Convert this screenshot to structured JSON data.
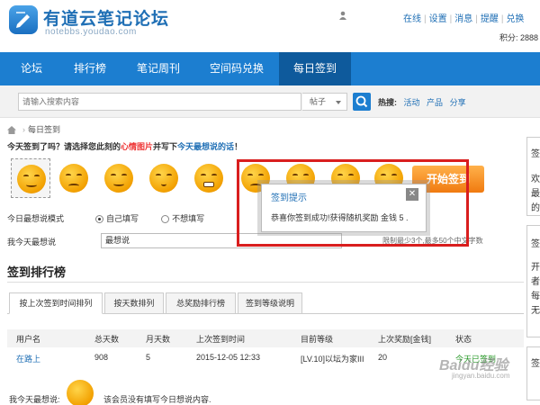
{
  "header": {
    "site_title": "有道云笔记论坛",
    "site_url": "notebbs.youdao.com",
    "top_links": [
      "在线",
      "设置",
      "消息",
      "提醒",
      "兑换"
    ],
    "points": "积分: 2888"
  },
  "nav": {
    "items": [
      "论坛",
      "排行榜",
      "笔记周刊",
      "空间码兑换",
      "每日签到"
    ],
    "active": "每日签到"
  },
  "search": {
    "placeholder": "请输入搜索内容",
    "scope": "帖子",
    "hot_label": "热搜:",
    "hot_words": [
      "活动",
      "产品",
      "分享"
    ]
  },
  "breadcrumb": {
    "current": "每日签到"
  },
  "signin": {
    "prompt_prefix": "今天签到了吗？请选择您此刻的",
    "prompt_mood": "心情图片",
    "prompt_mid": "并写下",
    "prompt_say": "今天最想说的话",
    "prompt_suffix": "！",
    "button_label": "开始签到",
    "mode_label": "今日最想说模式",
    "mode_option_1": "自己填写",
    "mode_option_2": "不想填写",
    "say_label": "我今天最想说",
    "say_value": "最想说",
    "limit_note": "限制最少3个,最多50个中文字数"
  },
  "dialog": {
    "title": "签到提示",
    "close": "✕",
    "message": "恭喜你签到成功!获得随机奖励 金钱 5 ."
  },
  "ranking": {
    "title": "签到排行榜",
    "tabs": [
      "按上次签到时间排列",
      "按天数排列",
      "总奖励排行榜",
      "签到等级说明"
    ],
    "columns": [
      "用户名",
      "总天数",
      "月天数",
      "上次签到时间",
      "目前等级",
      "上次奖励[金钱]",
      "状态"
    ],
    "rows": [
      [
        "在路上",
        "908",
        "5",
        "2015-12-05 12:33",
        "[LV.10]以坛为家III",
        "20",
        "今天已签到"
      ]
    ]
  },
  "bottom": {
    "say_label": "我今天最想说:",
    "note": "该会员没有填写今日想说内容."
  },
  "sidebar": {
    "chars": [
      "签",
      "欢",
      "最",
      "的",
      "签",
      "开",
      "者",
      "每",
      "无",
      "签"
    ]
  },
  "watermark": {
    "brand": "Baidu经验",
    "sub": "jingyan.baidu.com"
  },
  "colors": {
    "nav_bg": "#1c7ed0",
    "nav_active": "#0e5a9c",
    "highlight_red": "#d91e1e",
    "signin_orange": "#f07a10"
  }
}
